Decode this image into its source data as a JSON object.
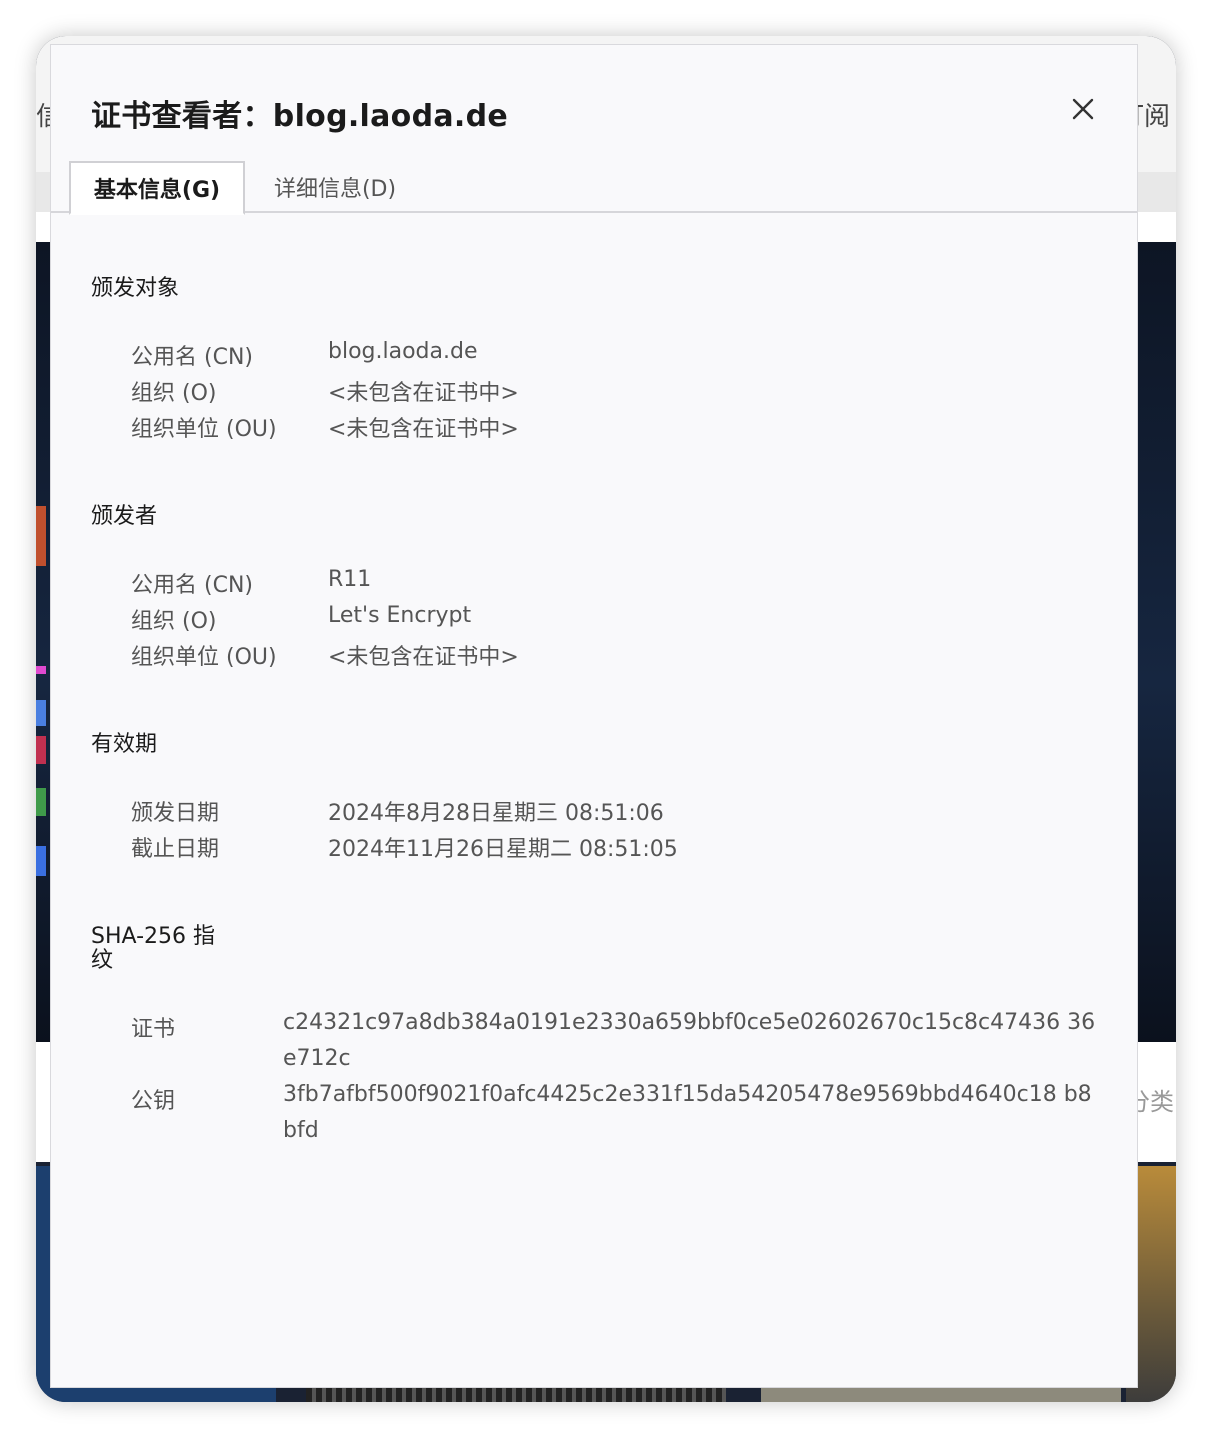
{
  "background": {
    "left_fragment": "信",
    "right_fragment": "订阅",
    "right_lower_fragment": "分类"
  },
  "dialog": {
    "title": "证书查看者：blog.laoda.de",
    "close_icon": "close-icon",
    "tabs": [
      {
        "label": "基本信息(G)",
        "active": true
      },
      {
        "label": "详细信息(D)",
        "active": false
      }
    ]
  },
  "issued_to": {
    "title": "颁发对象",
    "rows": [
      {
        "label": "公用名 (CN)",
        "value": "blog.laoda.de"
      },
      {
        "label": "组织 (O)",
        "value": "<未包含在证书中>"
      },
      {
        "label": "组织单位 (OU)",
        "value": "<未包含在证书中>"
      }
    ]
  },
  "issued_by": {
    "title": "颁发者",
    "rows": [
      {
        "label": "公用名 (CN)",
        "value": "R11"
      },
      {
        "label": "组织 (O)",
        "value": "Let's Encrypt"
      },
      {
        "label": "组织单位 (OU)",
        "value": "<未包含在证书中>"
      }
    ]
  },
  "validity": {
    "title": "有效期",
    "rows": [
      {
        "label": "颁发日期",
        "value": "2024年8月28日星期三 08:51:06"
      },
      {
        "label": "截止日期",
        "value": "2024年11月26日星期二 08:51:05"
      }
    ]
  },
  "fingerprints": {
    "title_line1": "SHA-256 指",
    "title_line2": "纹",
    "rows": [
      {
        "label": "证书",
        "value": "c24321c97a8db384a0191e2330a659bbf0ce5e02602670c15c8c47436 36e712c"
      },
      {
        "label": "公钥",
        "value": "3fb7afbf500f9021f0afc4425c2e331f15da54205478e9569bbd4640c18 b8bfd"
      }
    ]
  },
  "colors": {
    "dialog_bg": "#f9f9fb",
    "text_primary": "#1b1b1b",
    "text_secondary": "#555555"
  }
}
